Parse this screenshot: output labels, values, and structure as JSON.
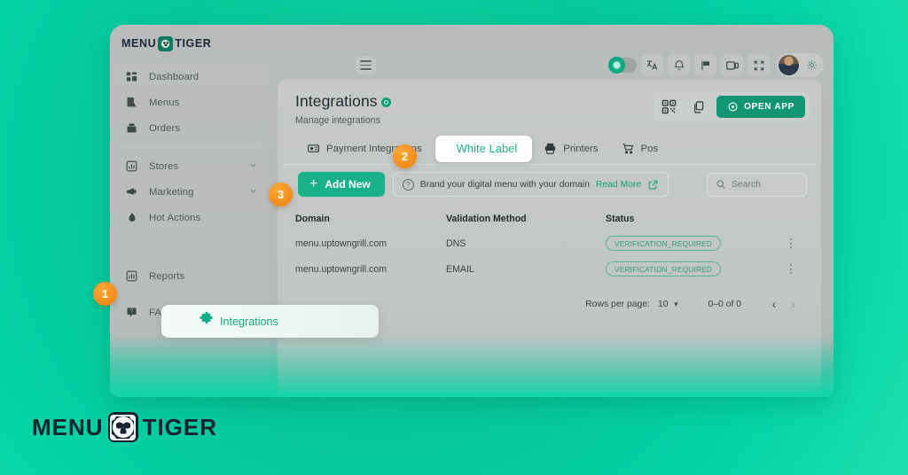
{
  "colors": {
    "page_bg_teal": "#07c79a",
    "accent_green": "#18b189",
    "step_badge_orange": "#f4901f",
    "active_tab_text": "#21b18b",
    "badge_border": "#4fb795"
  },
  "app": {
    "logo": {
      "word1": "MENU",
      "word2": "TIGER",
      "icon": "tiger-qr-icon"
    },
    "hamburger_icon": "hamburger-menu-icon",
    "topbar_icons": [
      {
        "name": "theme-toggle",
        "icon": "brightness-sun-icon"
      },
      {
        "name": "translate-button",
        "icon": "translate-icon"
      },
      {
        "name": "notifications-button",
        "icon": "bell-icon"
      },
      {
        "name": "flag-button",
        "icon": "flag-icon"
      },
      {
        "name": "device-preview-button",
        "icon": "tablet-device-icon"
      },
      {
        "name": "fullscreen-button",
        "icon": "expand-arrows-icon"
      },
      {
        "name": "user-avatar",
        "icon": "avatar-icon"
      },
      {
        "name": "settings-button",
        "icon": "gear-icon"
      }
    ]
  },
  "sidebar": {
    "items": [
      {
        "label": "Dashboard",
        "icon": "dashboard-icon",
        "expandable": false
      },
      {
        "label": "Menus",
        "icon": "menu-book-icon",
        "expandable": false
      },
      {
        "label": "Orders",
        "icon": "orders-box-icon",
        "expandable": false
      },
      {
        "label": "Stores",
        "icon": "store-chart-icon",
        "expandable": true
      },
      {
        "label": "Marketing",
        "icon": "megaphone-icon",
        "expandable": true
      },
      {
        "label": "Hot Actions",
        "icon": "flame-icon",
        "expandable": false
      },
      {
        "label": "Integrations",
        "icon": "puzzle-piece-icon",
        "expandable": false,
        "active": true
      },
      {
        "label": "Reports",
        "icon": "report-chart-icon",
        "expandable": false
      },
      {
        "label": "FAQ",
        "icon": "faq-help-icon",
        "expandable": false
      }
    ],
    "chevron_icon": "chevron-down-icon"
  },
  "page": {
    "title": "Integrations",
    "title_badge_icon": "info-dot-icon",
    "subtitle": "Manage integrations",
    "actions": {
      "qr_icon": "qr-code-icon",
      "copy_icon": "copy-icon",
      "open_app_label": "OPEN APP",
      "open_app_icon": "eye-icon"
    }
  },
  "tabs": [
    {
      "label": "Payment Integrations",
      "icon": "payment-card-icon",
      "active": false
    },
    {
      "label": "White Label",
      "icon": "",
      "active": true
    },
    {
      "label": "Printers",
      "icon": "printer-icon",
      "active": false
    },
    {
      "label": "Pos",
      "icon": "shopping-cart-icon",
      "active": false
    }
  ],
  "toolbar": {
    "add_new_label": "Add New",
    "add_new_icon": "plus-icon",
    "note_text": "Brand your digital menu with your domain",
    "note_icon": "question-mark-icon",
    "read_more_label": "Read More",
    "external_link_icon": "external-link-icon",
    "search": {
      "placeholder": "Search",
      "value": "",
      "icon": "search-icon"
    }
  },
  "table": {
    "columns": [
      "Domain",
      "Validation Method",
      "Status",
      ""
    ],
    "rows": [
      {
        "domain": "menu.uptowngrill.com",
        "validation_method": "DNS",
        "status": "VERIFICATION_REQUIRED",
        "menu_icon": "kebab-menu-icon"
      },
      {
        "domain": "menu.uptowngrill.com",
        "validation_method": "EMAIL",
        "status": "VERIFICATION_REQUIRED",
        "menu_icon": "kebab-menu-icon"
      }
    ]
  },
  "pagination": {
    "rows_per_page_label": "Rows per page:",
    "rows_per_page_value": "10",
    "caret_icon": "caret-down-icon",
    "range_label": "0–0 of 0",
    "prev_icon": "chevron-left-icon",
    "next_icon": "chevron-right-icon"
  },
  "steps": [
    {
      "number": "1"
    },
    {
      "number": "2"
    },
    {
      "number": "3"
    }
  ],
  "brand": {
    "word1": "MENU",
    "word2": "TIGER",
    "icon": "tiger-qr-icon"
  }
}
